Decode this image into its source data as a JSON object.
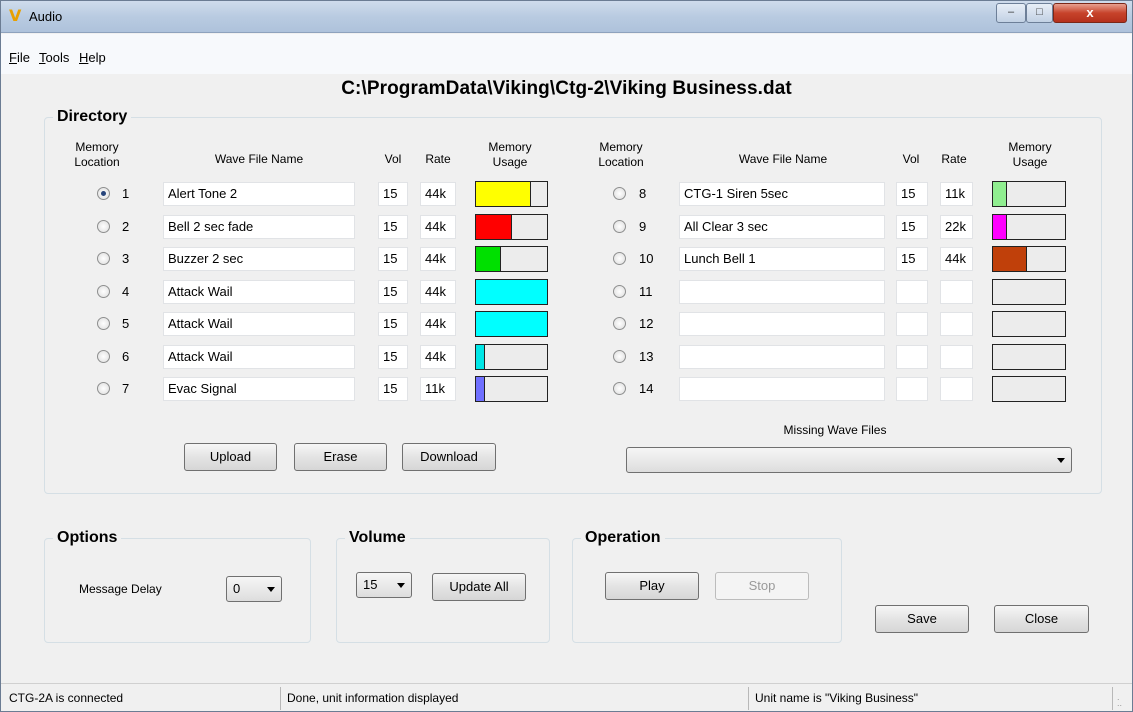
{
  "window": {
    "title": "Audio",
    "app_icon": "V",
    "close_glyph": "x",
    "min_glyph": "–",
    "max_glyph": "□"
  },
  "menu": [
    {
      "underline": "F",
      "rest": "ile"
    },
    {
      "underline": "T",
      "rest": "ools"
    },
    {
      "underline": "H",
      "rest": "elp"
    }
  ],
  "file_path": "C:\\ProgramData\\Viking\\Ctg-2\\Viking Business.dat",
  "directory": {
    "title": "Directory",
    "headers": {
      "memory_location": "Memory Location",
      "wave_file_name": "Wave File Name",
      "vol": "Vol",
      "rate": "Rate",
      "memory_usage": "Memory Usage"
    },
    "left_rows": [
      {
        "num": "1",
        "name": "Alert Tone 2",
        "vol": "15",
        "rate": "44k",
        "usage": 0.78,
        "color": "#ffff00",
        "selected": true
      },
      {
        "num": "2",
        "name": "Bell 2 sec fade",
        "vol": "15",
        "rate": "44k",
        "usage": 0.5,
        "color": "#ff0000",
        "selected": false
      },
      {
        "num": "3",
        "name": "Buzzer 2 sec",
        "vol": "15",
        "rate": "44k",
        "usage": 0.35,
        "color": "#00e000",
        "selected": false
      },
      {
        "num": "4",
        "name": "Attack Wail",
        "vol": "15",
        "rate": "44k",
        "usage": 1.0,
        "color": "#00ffff",
        "selected": false
      },
      {
        "num": "5",
        "name": "Attack Wail",
        "vol": "15",
        "rate": "44k",
        "usage": 1.0,
        "color": "#00ffff",
        "selected": false
      },
      {
        "num": "6",
        "name": "Attack Wail",
        "vol": "15",
        "rate": "44k",
        "usage": 0.13,
        "color": "#00e6e6",
        "selected": false
      },
      {
        "num": "7",
        "name": "Evac Signal",
        "vol": "15",
        "rate": "11k",
        "usage": 0.13,
        "color": "#7070ff",
        "selected": false
      }
    ],
    "right_rows": [
      {
        "num": "8",
        "name": "CTG-1 Siren 5sec",
        "vol": "15",
        "rate": "11k",
        "usage": 0.2,
        "color": "#90ee90",
        "selected": false
      },
      {
        "num": "9",
        "name": "All Clear 3 sec",
        "vol": "15",
        "rate": "22k",
        "usage": 0.2,
        "color": "#ff00ff",
        "selected": false
      },
      {
        "num": "10",
        "name": "Lunch Bell 1",
        "vol": "15",
        "rate": "44k",
        "usage": 0.47,
        "color": "#c0400a",
        "selected": false
      },
      {
        "num": "11",
        "name": "",
        "vol": "",
        "rate": "",
        "usage": 0,
        "color": "#ffffff",
        "selected": false
      },
      {
        "num": "12",
        "name": "",
        "vol": "",
        "rate": "",
        "usage": 0,
        "color": "#ffffff",
        "selected": false
      },
      {
        "num": "13",
        "name": "",
        "vol": "",
        "rate": "",
        "usage": 0,
        "color": "#ffffff",
        "selected": false
      },
      {
        "num": "14",
        "name": "",
        "vol": "",
        "rate": "",
        "usage": 0,
        "color": "#ffffff",
        "selected": false
      }
    ],
    "buttons": {
      "upload": "Upload",
      "erase": "Erase",
      "download": "Download"
    },
    "missing_wave_files_label": "Missing Wave Files",
    "missing_wave_files_value": ""
  },
  "options": {
    "title": "Options",
    "message_delay_label": "Message Delay",
    "message_delay_value": "0"
  },
  "volume": {
    "title": "Volume",
    "value": "15",
    "update_all": "Update All"
  },
  "operation": {
    "title": "Operation",
    "play": "Play",
    "stop": "Stop"
  },
  "actions": {
    "save": "Save",
    "close": "Close"
  },
  "status": {
    "connection": "CTG-2A is connected",
    "message": "Done, unit information displayed",
    "unit_name": "Unit name is \"Viking Business\""
  }
}
